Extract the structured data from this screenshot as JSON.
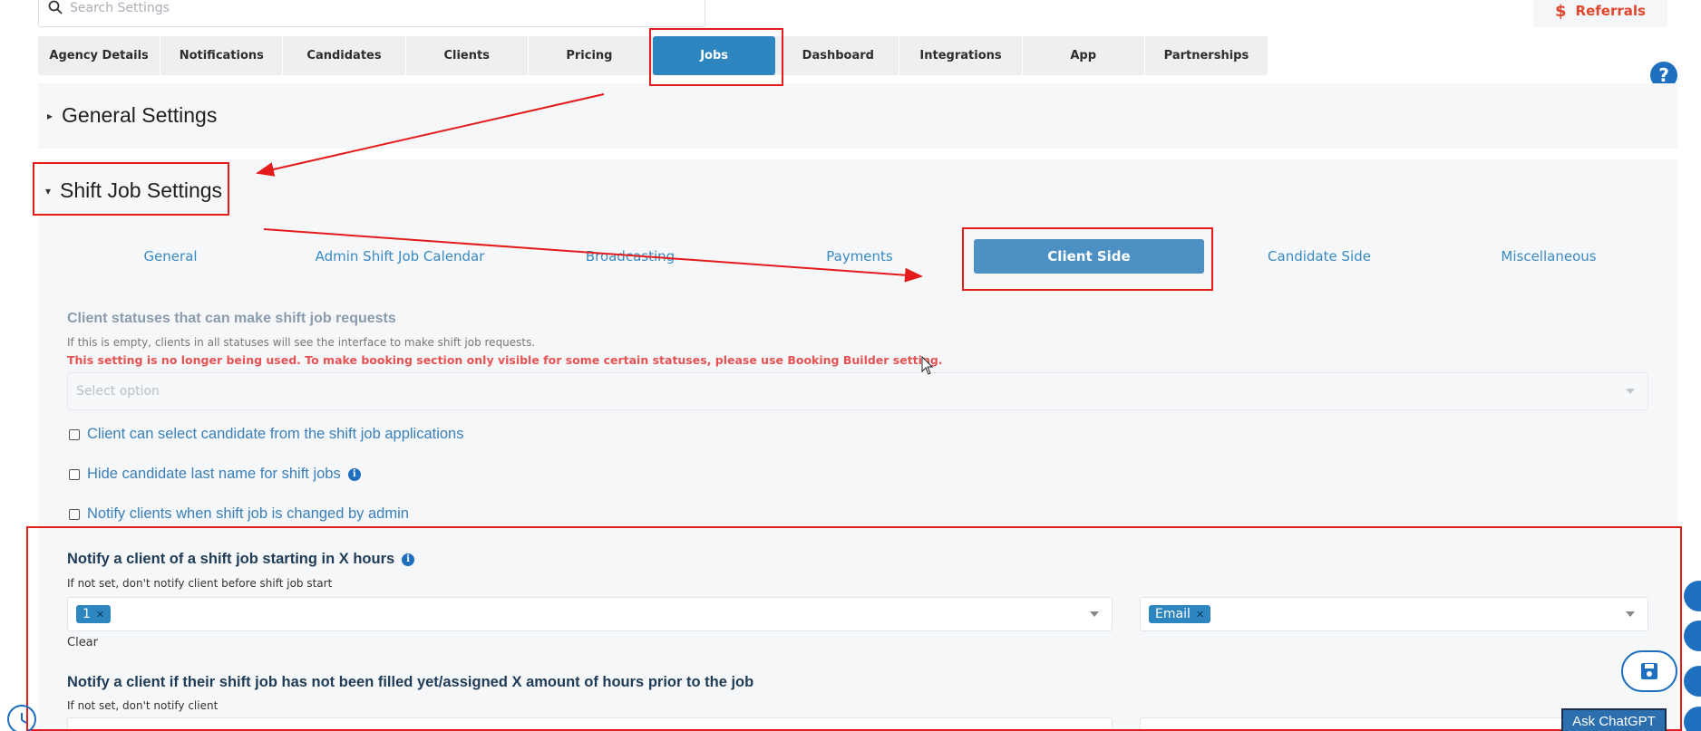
{
  "search": {
    "placeholder": "Search Settings"
  },
  "referrals": {
    "label": "Referrals",
    "color": "#e0462e"
  },
  "top_tabs": [
    "Agency Details",
    "Notifications",
    "Candidates",
    "Clients",
    "Pricing",
    "Jobs",
    "Dashboard",
    "Integrations",
    "App",
    "Partnerships"
  ],
  "active_top_tab": "Jobs",
  "sections": {
    "general": {
      "title": "General Settings",
      "expanded": false
    },
    "shift": {
      "title": "Shift Job Settings",
      "expanded": true
    }
  },
  "sub_tabs": [
    "General",
    "Admin Shift Job Calendar",
    "Broadcasting",
    "Payments",
    "Client Side",
    "Candidate Side",
    "Miscellaneous"
  ],
  "active_sub_tab": "Client Side",
  "client_statuses": {
    "label": "Client statuses that can make shift job requests",
    "hint": "If this is empty, clients in all statuses will see the interface to make shift job requests.",
    "warning": "This setting is no longer being used. To make booking section only visible for some certain statuses, please use Booking Builder setting.",
    "placeholder": "Select option"
  },
  "checkboxes": [
    {
      "label": "Client can select candidate from the shift job applications",
      "checked": false,
      "info": false
    },
    {
      "label": "Hide candidate last name for shift jobs",
      "checked": false,
      "info": true
    },
    {
      "label": "Notify clients when shift job is changed by admin",
      "checked": false,
      "info": false
    }
  ],
  "notify_start": {
    "label": "Notify a client of a shift job starting in X hours",
    "hint": "If not set, don't notify client before shift job start",
    "value_tag": "1",
    "channel_tag": "Email",
    "clear_label": "Clear"
  },
  "notify_unfilled": {
    "label": "Notify a client if their shift job has not been filled yet/assigned X amount of hours prior to the job",
    "hint": "If not set, don't notify client"
  },
  "ask_chatgpt": {
    "label": "Ask ChatGPT"
  },
  "colors": {
    "accent": "#2e86c1",
    "annotation": "#e41b1b",
    "warning": "#e55353"
  }
}
